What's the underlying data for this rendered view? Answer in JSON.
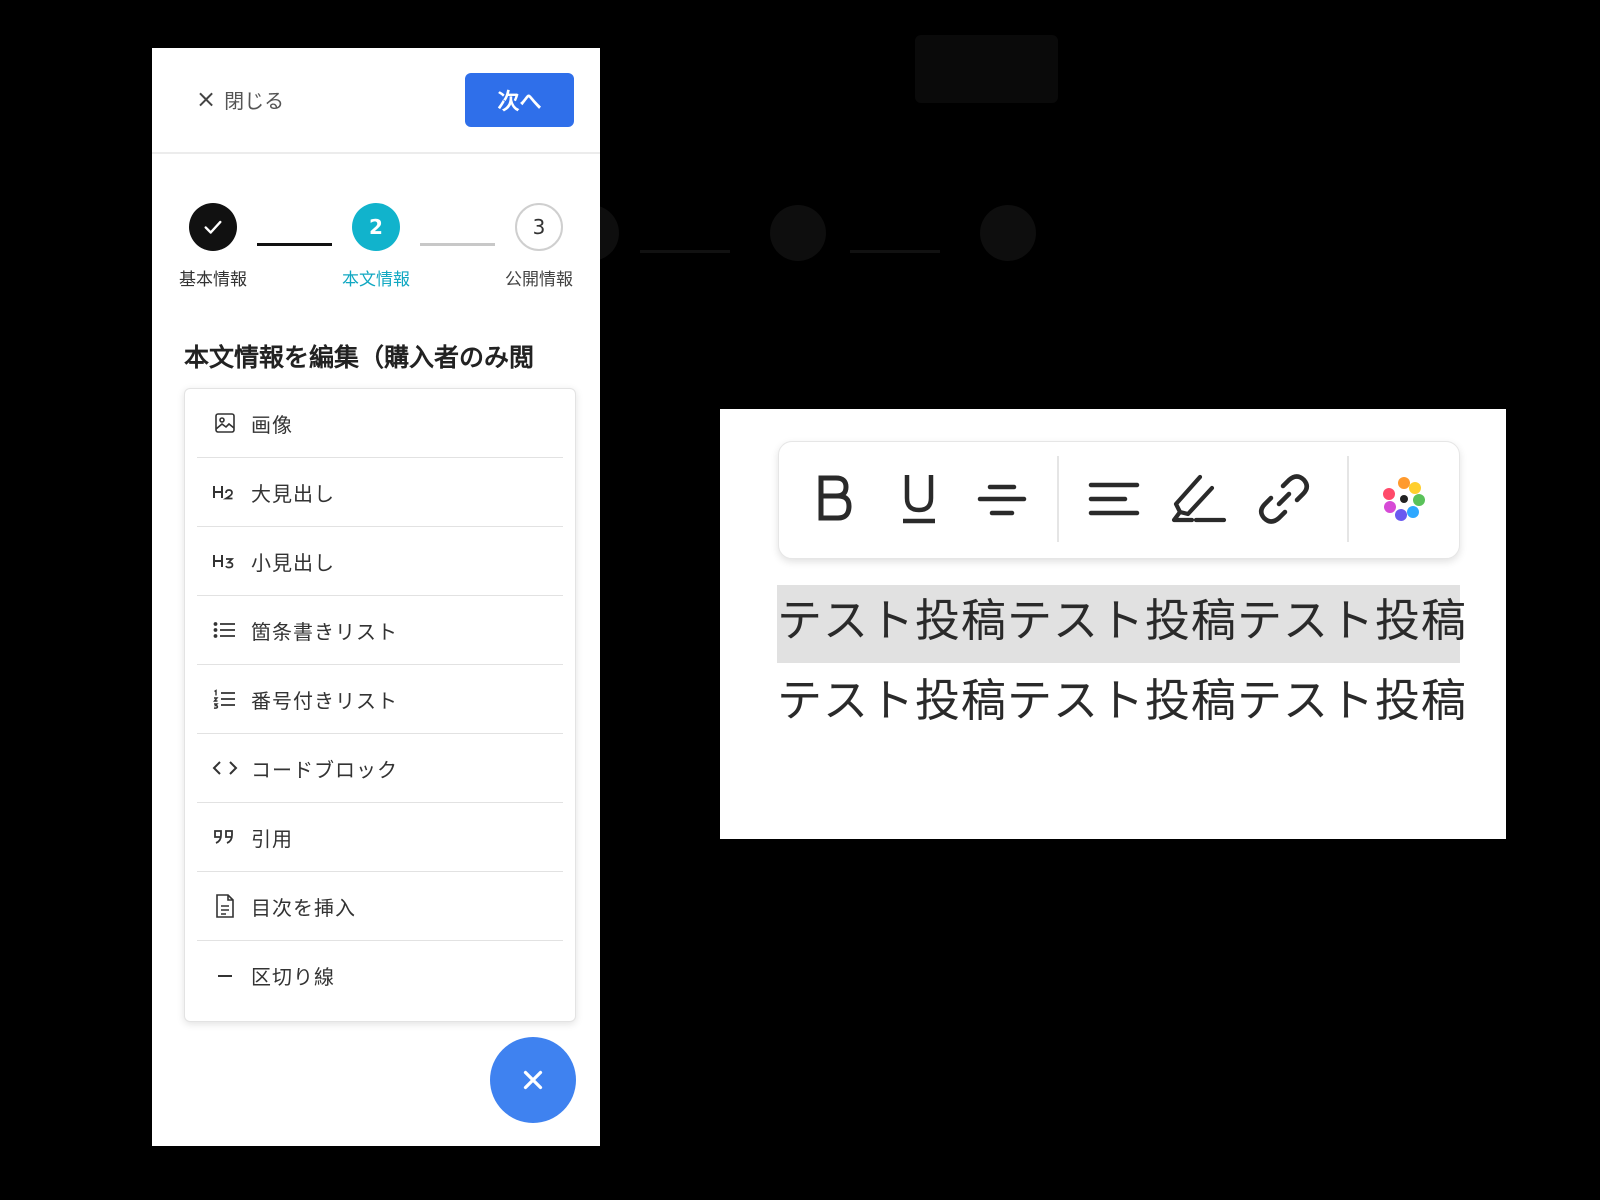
{
  "header": {
    "close_label": "閉じる",
    "next_label": "次へ"
  },
  "stepper": {
    "steps": [
      {
        "number": "",
        "label": "基本情報",
        "state": "done"
      },
      {
        "number": "2",
        "label": "本文情報",
        "state": "active"
      },
      {
        "number": "3",
        "label": "公開情報",
        "state": "todo"
      }
    ]
  },
  "section_title": "本文情報を編集（購入者のみ閲",
  "menu": {
    "items": [
      {
        "icon": "image-icon",
        "label": "画像"
      },
      {
        "icon": "heading-2-icon",
        "label": "大見出し"
      },
      {
        "icon": "heading-3-icon",
        "label": "小見出し"
      },
      {
        "icon": "bullet-list-icon",
        "label": "箇条書きリスト"
      },
      {
        "icon": "numbered-list-icon",
        "label": "番号付きリスト"
      },
      {
        "icon": "code-icon",
        "label": "コードブロック"
      },
      {
        "icon": "quote-icon",
        "label": "引用"
      },
      {
        "icon": "document-icon",
        "label": "目次を挿入"
      },
      {
        "icon": "divider-icon",
        "label": "区切り線"
      }
    ]
  },
  "fab": {
    "icon": "close-icon"
  },
  "inset": {
    "toolbar": [
      "bold-icon",
      "underline-icon",
      "strikethrough-icon",
      "align-icon",
      "highlighter-icon",
      "link-icon",
      "color-palette-icon"
    ],
    "text": "テスト投稿テスト投稿テスト投稿テスト投稿テスト投稿テスト投稿"
  },
  "colors": {
    "primary": "#2f6fea",
    "accent": "#11b3cc",
    "fab": "#3f82f0",
    "selection": "#e1e1e1"
  }
}
